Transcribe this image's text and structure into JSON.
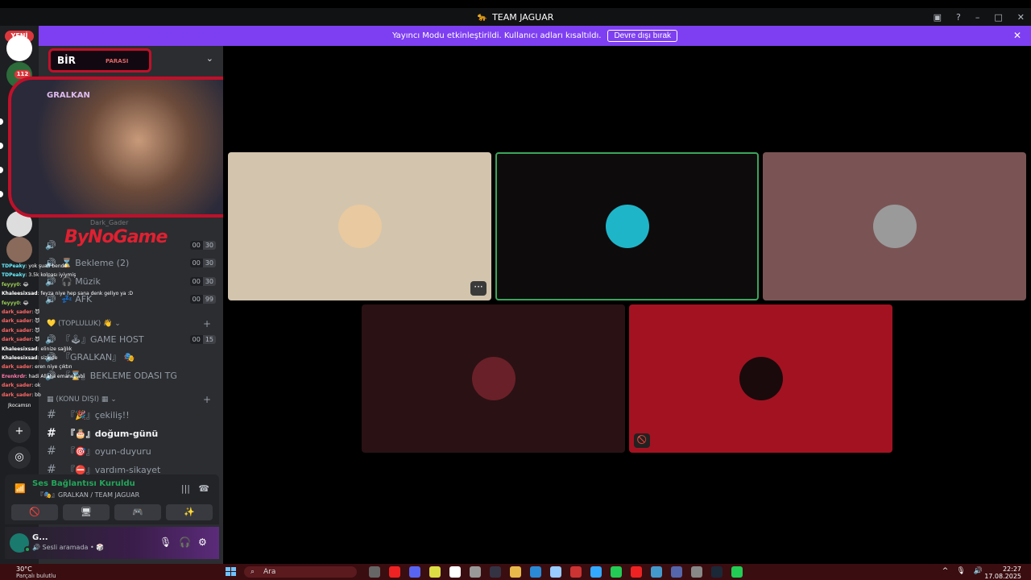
{
  "window": {
    "title": "TEAM JAGUAR",
    "controls": {
      "monitor": "▣",
      "help": "?",
      "minimize": "–",
      "maximize": "□",
      "close": "✕"
    }
  },
  "banner": {
    "message": "Yayıncı Modu etkinleştirildi. Kullanıcı adları kısaltıldı.",
    "button": "Devre dışı bırak",
    "close": "✕"
  },
  "rail": {
    "new_badge": "YENİ",
    "count_badge": "112",
    "add_label": "+",
    "discover_label": "◎"
  },
  "overlay": {
    "logo_word": "BİR",
    "logo_sub": "PARASI",
    "cam_label": "GRALKAN",
    "brand": "ByNoGame",
    "user_tag": "Dark_Gader"
  },
  "chat": [
    {
      "user": "TDPeaky",
      "text": ": yok şuan bende",
      "cls": "c1"
    },
    {
      "user": "TDPeaky",
      "text": ": 3.5k kolpası iyiymiş",
      "cls": "c1"
    },
    {
      "user": "feyyy0",
      "text": ": 😂",
      "cls": "c3"
    },
    {
      "user": "Khaleesixsad",
      "text": ": feyza niye hep sana denk geliyo ya :D",
      "cls": "c4"
    },
    {
      "user": "feyyy0",
      "text": ": 😂",
      "cls": "c3"
    },
    {
      "user": "dark_sader",
      "text": ": 😈",
      "cls": "c2"
    },
    {
      "user": "dark_sader",
      "text": ": 😈",
      "cls": "c2"
    },
    {
      "user": "dark_sader",
      "text": ": 😈",
      "cls": "c2"
    },
    {
      "user": "dark_sader",
      "text": ": 😈",
      "cls": "c2"
    },
    {
      "user": "Khaleesixsad",
      "text": ": elinize sağlık",
      "cls": "c4"
    },
    {
      "user": "Khaleesixsad",
      "text": ": sizinde",
      "cls": "c4"
    },
    {
      "user": "dark_sader",
      "text": ": eren niye çıktın",
      "cls": "c2"
    },
    {
      "user": "Erenkrdr",
      "text": ": hadi Allaha emanet abi",
      "cls": "c5"
    },
    {
      "user": "dark_sader",
      "text": ": ok",
      "cls": "c2"
    },
    {
      "user": "dark_sader",
      "text": ": bb",
      "cls": "c2"
    }
  ],
  "chat_note": "Jkocamsn",
  "voice_channels": [
    {
      "icon": "🔊",
      "name": "",
      "lim_a": "00",
      "lim_b": "30"
    },
    {
      "icon": "🔊",
      "name": "⌛ Bekleme (2)",
      "lim_a": "00",
      "lim_b": "30"
    },
    {
      "icon": "🔊",
      "name": "🎧 Müzik",
      "lim_a": "00",
      "lim_b": "30"
    },
    {
      "icon": "🔊",
      "name": "💤 AFK",
      "lim_a": "00",
      "lim_b": "99"
    }
  ],
  "categories": [
    {
      "label": "💛 (TOPLULUK) 👋 ⌄",
      "plus": "+"
    },
    {
      "label": "▦ (KONU DIŞI) ▦ ⌄",
      "plus": "+"
    }
  ],
  "topluluk_channels": [
    {
      "icon": "🔊",
      "name": "『🕹』GAME HOST",
      "lim_a": "00",
      "lim_b": "15"
    },
    {
      "icon": "🔊",
      "name": "『GRALKAN』 🎭",
      "lim_a": "",
      "lim_b": ""
    },
    {
      "icon": "🔊",
      "name": "『⌛』BEKLEME ODASI TG",
      "lim_a": "",
      "lim_b": ""
    }
  ],
  "text_channels": [
    {
      "name": "『🎉』çekiliş!!"
    },
    {
      "name": "『🎂』doğum-günü"
    },
    {
      "name": "『🎯』oyun-duyuru"
    },
    {
      "name": "『⛔』vardım-sikayet"
    }
  ],
  "voice_panel": {
    "status": "Ses Bağlantısı Kuruldu",
    "sub": "『🎭』GRALKAN / TEAM JAGUAR",
    "signal_icon": "📶",
    "noise_icon": "|||",
    "disconnect_icon": "☎",
    "buttons": [
      "🚫",
      "🖥",
      "🎮",
      "✨"
    ]
  },
  "user": {
    "name": "G...",
    "status": "🔊 Sesli aramada • 🎲",
    "mic": "🎙",
    "headset": "🎧",
    "settings": "⚙"
  },
  "tiles": [
    {
      "name": "tile-cat",
      "bg": "#d3c4ad",
      "ava": "#e8c9a0",
      "more": "···",
      "mute": ""
    },
    {
      "name": "tile-speaking",
      "bg": "#0e0b0c",
      "ava": "#1fb5c8",
      "more": "",
      "mute": ""
    },
    {
      "name": "tile-einstein",
      "bg": "#7a5454",
      "ava": "#9a9a9a",
      "more": "",
      "mute": ""
    },
    {
      "name": "tile-soldier",
      "bg": "#2a1114",
      "ava": "#6a2028",
      "more": "",
      "mute": ""
    },
    {
      "name": "tile-vader",
      "bg": "#a31221",
      "ava": "#1a0a0c",
      "more": "",
      "mute": "🚫"
    }
  ],
  "taskbar": {
    "temp": "30°C",
    "weather": "Parçalı bulutlu",
    "search": "Ara",
    "time": "22:27",
    "date": "17.08.2025",
    "tray": [
      "^",
      "🎙",
      "🔊"
    ]
  }
}
